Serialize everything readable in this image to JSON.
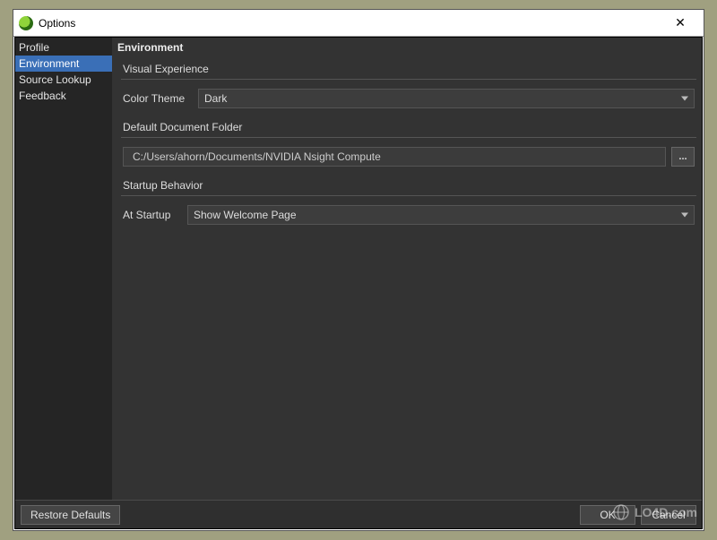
{
  "window": {
    "title": "Options"
  },
  "sidebar": {
    "items": [
      {
        "label": "Profile",
        "selected": false
      },
      {
        "label": "Environment",
        "selected": true
      },
      {
        "label": "Source Lookup",
        "selected": false
      },
      {
        "label": "Feedback",
        "selected": false
      }
    ]
  },
  "page": {
    "header": "Environment",
    "sections": {
      "visual_experience": {
        "title": "Visual Experience",
        "color_theme": {
          "label": "Color Theme",
          "value": "Dark"
        }
      },
      "default_document_folder": {
        "title": "Default Document Folder",
        "path": "C:/Users/ahorn/Documents/NVIDIA Nsight Compute",
        "browse_label": "..."
      },
      "startup_behavior": {
        "title": "Startup Behavior",
        "at_startup": {
          "label": "At Startup",
          "value": "Show Welcome Page"
        }
      }
    }
  },
  "buttons": {
    "restore_defaults": "Restore Defaults",
    "ok": "OK",
    "cancel": "Cancel"
  },
  "watermark": "LO4D.com"
}
